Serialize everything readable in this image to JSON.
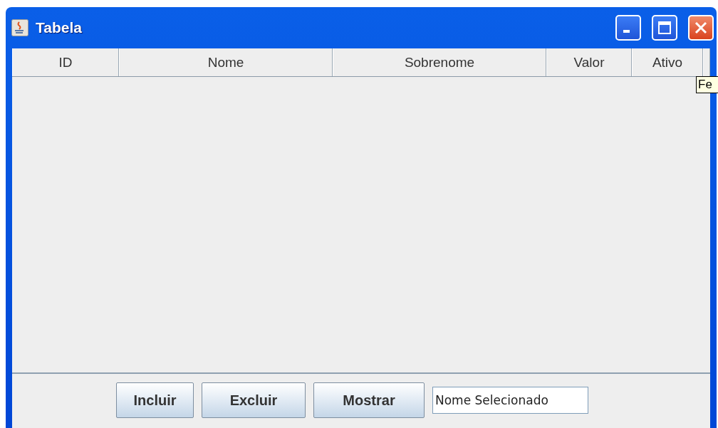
{
  "window": {
    "title": "Tabela"
  },
  "table": {
    "columns": [
      "ID",
      "Nome",
      "Sobrenome",
      "Valor",
      "Ativo"
    ]
  },
  "tooltip": {
    "text": "Fe"
  },
  "buttons": [
    "Incluir",
    "Excluir",
    "Mostrar"
  ],
  "field": {
    "value": "Nome Selecionado"
  }
}
